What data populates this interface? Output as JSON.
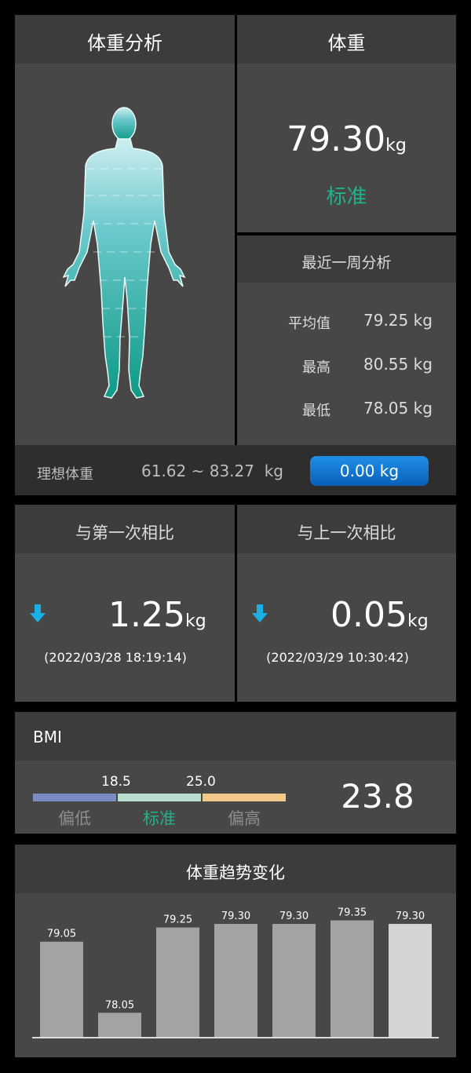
{
  "analysis": {
    "title": "体重分析",
    "ideal_label": "理想体重",
    "ideal_range": "61.62 ~ 83.27",
    "ideal_unit": "kg",
    "diff_button": "0.00 kg"
  },
  "weight": {
    "title": "体重",
    "value": "79.30",
    "unit": "kg",
    "status": "标准",
    "status_color": "#1fb38a"
  },
  "weekly": {
    "title": "最近一周分析",
    "rows": [
      {
        "label": "平均值",
        "value": "79.25 kg"
      },
      {
        "label": "最高",
        "value": "80.55 kg"
      },
      {
        "label": "最低",
        "value": "78.05 kg"
      }
    ]
  },
  "compare_first": {
    "title": "与第一次相比",
    "value": "1.25",
    "unit": "kg",
    "date": "(2022/03/28 18:19:14)",
    "direction": "down-arrow-icon"
  },
  "compare_last": {
    "title": "与上一次相比",
    "value": "0.05",
    "unit": "kg",
    "date": "(2022/03/29 10:30:42)",
    "direction": "down-arrow-icon"
  },
  "bmi": {
    "title": "BMI",
    "threshold_low": "18.5",
    "threshold_high": "25.0",
    "seg_low": "偏低",
    "seg_mid": "标准",
    "seg_high": "偏高",
    "value": "23.8",
    "colors": {
      "low": "#7b8cc2",
      "mid": "#b8ddd0",
      "high": "#f2c98a"
    }
  },
  "trend": {
    "title": "体重趋势变化"
  },
  "chart_data": {
    "type": "bar",
    "title": "体重趋势变化",
    "values": [
      79.05,
      78.05,
      79.25,
      79.3,
      79.3,
      79.35,
      79.3
    ],
    "labels": [
      "79.05",
      "78.05",
      "79.25",
      "79.30",
      "79.30",
      "79.35",
      "79.30"
    ],
    "ylim": [
      77.7,
      79.4
    ],
    "highlight_last": true
  }
}
